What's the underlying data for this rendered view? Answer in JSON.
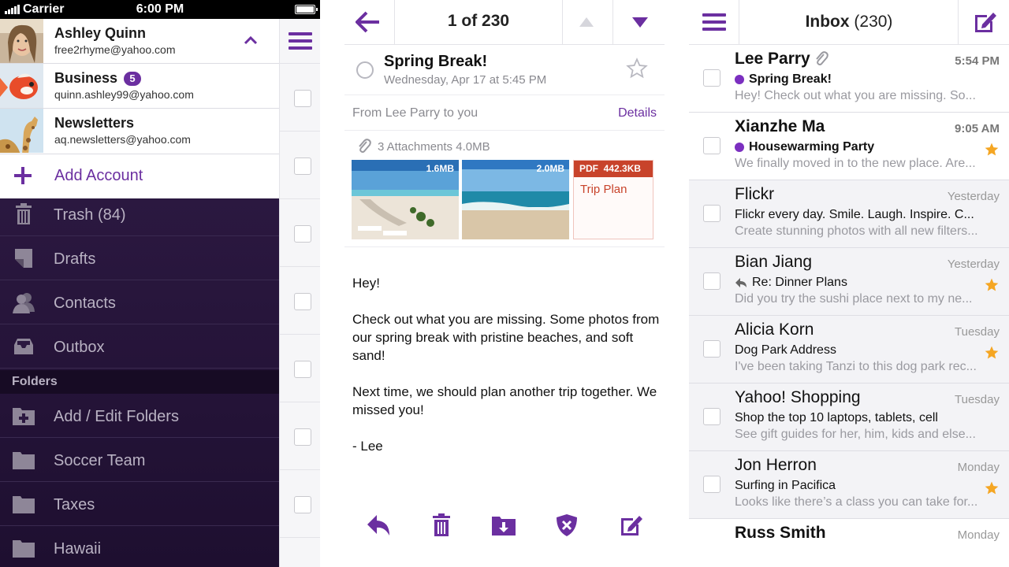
{
  "status_bar": {
    "carrier": "Carrier",
    "time": "6:00 PM"
  },
  "accounts": [
    {
      "name": "Ashley Quinn",
      "email": "free2rhyme@yahoo.com",
      "badge": ""
    },
    {
      "name": "Business",
      "email": "quinn.ashley99@yahoo.com",
      "badge": "5"
    },
    {
      "name": "Newsletters",
      "email": "aq.newsletters@yahoo.com",
      "badge": ""
    }
  ],
  "add_account_label": "Add Account",
  "menu_items": [
    {
      "label": "Trash (84)",
      "icon": "trash-icon"
    },
    {
      "label": "Drafts",
      "icon": "drafts-icon"
    },
    {
      "label": "Contacts",
      "icon": "contacts-icon"
    },
    {
      "label": "Outbox",
      "icon": "outbox-icon"
    }
  ],
  "folders_header": "Folders",
  "folder_items": [
    {
      "label": "Add / Edit Folders",
      "icon": "add-folder-icon"
    },
    {
      "label": "Soccer Team",
      "icon": "folder-icon"
    },
    {
      "label": "Taxes",
      "icon": "folder-icon"
    },
    {
      "label": "Hawaii",
      "icon": "folder-icon"
    }
  ],
  "message": {
    "counter": "1 of 230",
    "subject": "Spring Break!",
    "date": "Wednesday, Apr 17 at 5:45 PM",
    "from_line": "From Lee Parry to you",
    "details_label": "Details",
    "attachments_info": "3 Attachments  4.0MB",
    "attachments": [
      {
        "type": "image",
        "size": "1.6MB"
      },
      {
        "type": "image",
        "size": "2.0MB"
      },
      {
        "type": "pdf",
        "badge": "PDF",
        "size": "442.3KB",
        "name": "Trip Plan"
      }
    ],
    "body": [
      "Hey!",
      "Check out what you are missing. Some photos from our spring break with pristine beaches, and soft sand!",
      "Next time, we should plan another trip together. We missed you!",
      "- Lee"
    ]
  },
  "inbox": {
    "title": "Inbox",
    "count": "(230)",
    "messages": [
      {
        "sender": "Lee Parry",
        "time": "5:54 PM",
        "subject": "Spring Break!",
        "preview": "Hey! Check out what you are missing. So...",
        "unread": true,
        "starred": false,
        "attachment": true,
        "replied": false
      },
      {
        "sender": "Xianzhe Ma",
        "time": "9:05 AM",
        "subject": "Housewarming Party",
        "preview": "We finally moved in to the new place. Are...",
        "unread": true,
        "starred": true,
        "attachment": false,
        "replied": false
      },
      {
        "sender": "Flickr",
        "time": "Yesterday",
        "subject": "Flickr every day. Smile. Laugh. Inspire. C...",
        "preview": "Create stunning photos with all new filters...",
        "unread": false,
        "starred": false,
        "attachment": false,
        "replied": false
      },
      {
        "sender": "Bian Jiang",
        "time": "Yesterday",
        "subject": "Re: Dinner Plans",
        "preview": "Did you try the sushi place next to my ne...",
        "unread": false,
        "starred": true,
        "attachment": false,
        "replied": true
      },
      {
        "sender": "Alicia Korn",
        "time": "Tuesday",
        "subject": "Dog Park Address",
        "preview": "I've been taking Tanzi to this dog park rec...",
        "unread": false,
        "starred": true,
        "attachment": false,
        "replied": false
      },
      {
        "sender": "Yahoo! Shopping",
        "time": "Tuesday",
        "subject": "Shop the top 10 laptops, tablets, cell",
        "preview": "See gift guides for her, him, kids and else...",
        "unread": false,
        "starred": false,
        "attachment": false,
        "replied": false
      },
      {
        "sender": "Jon Herron",
        "time": "Monday",
        "subject": "Surfing in Pacifica",
        "preview": "Looks like there’s a class you can take for...",
        "unread": false,
        "starred": true,
        "attachment": false,
        "replied": false
      },
      {
        "sender": "Russ Smith",
        "time": "Monday",
        "subject": "",
        "preview": "",
        "unread": true,
        "starred": false,
        "attachment": false,
        "replied": false
      }
    ]
  },
  "colors": {
    "accent": "#6b2fa0",
    "unread_dot": "#7b2fc0",
    "star": "#f5a623",
    "menu_bg": "#2b1840",
    "pdf_red": "#c8432b"
  }
}
